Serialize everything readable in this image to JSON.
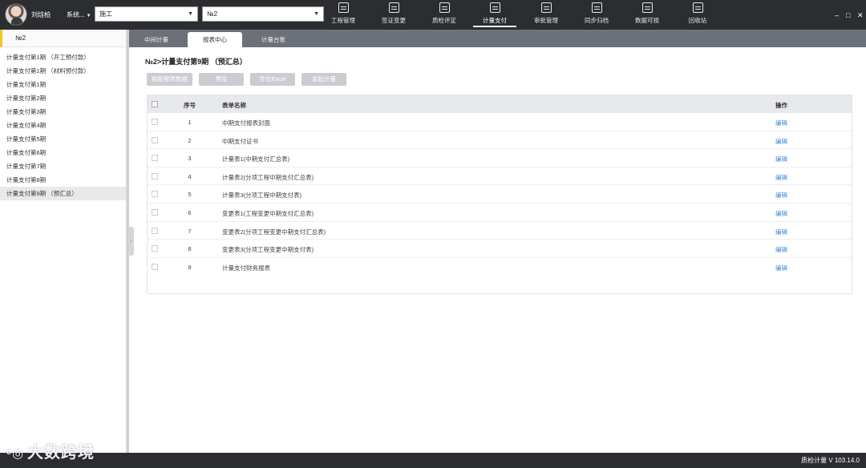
{
  "topbar": {
    "user_name": "刘焓柏",
    "system_menu": "系统...",
    "select_unit": "施工",
    "select_section": "№2",
    "nav": [
      {
        "label": "工程管理",
        "icon": "project-icon"
      },
      {
        "label": "签证变更",
        "icon": "change-icon"
      },
      {
        "label": "质检评定",
        "icon": "inspection-icon"
      },
      {
        "label": "计量支付",
        "icon": "payment-icon",
        "active": true
      },
      {
        "label": "审批管理",
        "icon": "approval-icon"
      },
      {
        "label": "同步归档",
        "icon": "archive-icon"
      },
      {
        "label": "数据可视",
        "icon": "data-visual-icon"
      },
      {
        "label": "回收站",
        "icon": "recycle-icon"
      }
    ],
    "window_controls": {
      "minimize": "–",
      "maximize": "□",
      "close": "✕"
    }
  },
  "sidebar": {
    "header": "№2",
    "items": [
      "计量支付第1期 （开工预付款）",
      "计量支付第1期 （材料预付款）",
      "计量支付第1期",
      "计量支付第2期",
      "计量支付第3期",
      "计量支付第4期",
      "计量支付第5期",
      "计量支付第6期",
      "计量支付第7期",
      "计量支付第8期",
      "计量支付第9期 （预汇总）"
    ],
    "selected_index": 10
  },
  "tabs": [
    {
      "label": "中间计量"
    },
    {
      "label": "报表中心",
      "active": true
    },
    {
      "label": "计量台账"
    }
  ],
  "main": {
    "breadcrumb": "№2>计量支付第9期 （预汇总）",
    "toolbar": {
      "refresh": "刷新报表数据",
      "preview": "预览",
      "export": "导出Excel",
      "submit": "发起计量"
    },
    "table": {
      "columns": {
        "no": "序号",
        "name": "表单名称",
        "op": "操作"
      },
      "rows": [
        {
          "no": "1",
          "name": "中期支付报表封面",
          "op": "编辑"
        },
        {
          "no": "2",
          "name": "中期支付证书",
          "op": "编辑"
        },
        {
          "no": "3",
          "name": "计量表1(中期支付汇总表)",
          "op": "编辑"
        },
        {
          "no": "4",
          "name": "计量表2(分项工程中期支付汇总表)",
          "op": "编辑"
        },
        {
          "no": "5",
          "name": "计量表3(分项工程中期支付表)",
          "op": "编辑"
        },
        {
          "no": "6",
          "name": "变更表1(工程变更中期支付汇总表)",
          "op": "编辑"
        },
        {
          "no": "7",
          "name": "变更表2(分项工程变更中期支付汇总表)",
          "op": "编辑"
        },
        {
          "no": "8",
          "name": "变更表3(分项工程变更中期支付表)",
          "op": "编辑"
        },
        {
          "no": "9",
          "name": "计量支付财务报表",
          "op": "编辑"
        }
      ]
    }
  },
  "status": {
    "version": "质检计量 V 103.14.0",
    "watermark": "大数跨境"
  },
  "colors": {
    "topbar_bg": "#2b2d31",
    "tab_bar_bg": "#6b7079",
    "accent_yellow": "#f5c518",
    "link_blue": "#3a86d8",
    "disabled_button": "#c9ccd1"
  }
}
